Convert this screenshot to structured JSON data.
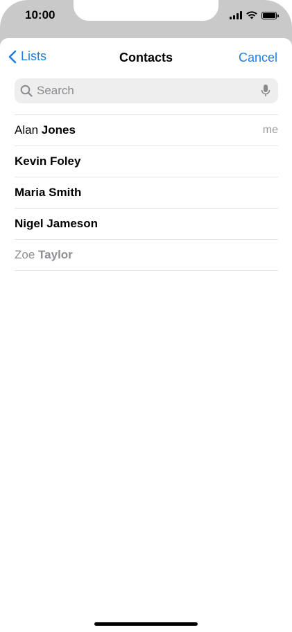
{
  "status": {
    "time": "10:00"
  },
  "nav": {
    "back_label": "Lists",
    "title": "Contacts",
    "cancel_label": "Cancel"
  },
  "search": {
    "placeholder": "Search"
  },
  "contacts": [
    {
      "first": "Alan",
      "last": "Jones",
      "tag": "me"
    },
    {
      "first": "Kevin",
      "last": "Foley",
      "tag": ""
    },
    {
      "first": "Maria",
      "last": "Smith",
      "tag": ""
    },
    {
      "first": "Nigel",
      "last": "Jameson",
      "tag": ""
    },
    {
      "first": "Zoe",
      "last": "Taylor",
      "tag": ""
    }
  ],
  "colors": {
    "accent": "#1a7ee6",
    "dimmed": "#8e8e93"
  }
}
